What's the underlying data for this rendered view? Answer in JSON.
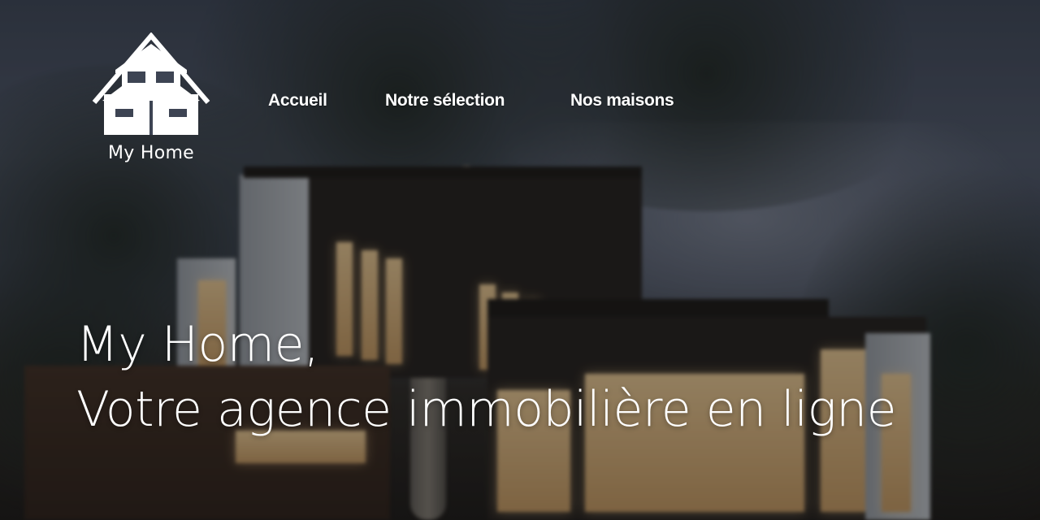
{
  "brand": {
    "name": "My Home",
    "logo_icon": "house-icon"
  },
  "nav": {
    "items": [
      {
        "label": "Accueil"
      },
      {
        "label": "Notre sélection"
      },
      {
        "label": "Nos maisons"
      }
    ]
  },
  "hero": {
    "line1": "My Home,",
    "line2": "Votre agence immobilière en ligne",
    "background_image": "modern-house-at-dusk-photo"
  },
  "colors": {
    "text": "#ffffff",
    "overlay": "#0f1014"
  }
}
